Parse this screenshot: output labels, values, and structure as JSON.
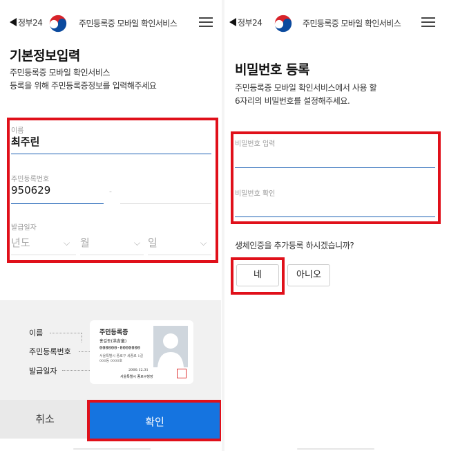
{
  "topbar": {
    "back_label": "정부24",
    "service_title": "주민등록증 모바일 확인서비스",
    "logo_icon": "gov-taegeuk-logo",
    "menu_icon": "hamburger-menu-icon"
  },
  "left": {
    "heading": "기본정보입력",
    "description_line1": "주민등록증 모바일 확인서비스",
    "description_line2": "등록을 위해 주민등록증정보를 입력해주세요",
    "name_label": "이름",
    "name_value": "최주린",
    "rrn_label": "주민등록번호",
    "rrn_front": "950629",
    "rrn_separator": "-",
    "issue_label": "발급일자",
    "year_placeholder": "년도",
    "month_placeholder": "월",
    "day_placeholder": "일",
    "example": {
      "label_name": "이름",
      "label_rrn": "주민등록번호",
      "label_issue": "발급일자",
      "card_title": "주민등록증",
      "card_name": "홍길동(洪吉童)",
      "card_number": "000000-0000000",
      "card_address1": "서울특별시 종로구 세종로 1길",
      "card_address2": "000동 0000호",
      "card_date": "2000.12.31",
      "card_issuer": "서울특별시 종로구청장"
    },
    "cancel_label": "취소",
    "confirm_label": "확인"
  },
  "right": {
    "heading": "비밀번호 등록",
    "description_line1": "주민등록증 모바일 확인서비스에서 사용 할",
    "description_line2": "6자리의 비밀번호를 설정해주세요.",
    "pw_label": "비밀번호 입력",
    "pw_confirm_label": "비밀번호 확인",
    "biometric_question": "생체인증을 추가등록 하시겠습니까?",
    "yes_label": "네",
    "no_label": "아니오"
  },
  "colors": {
    "accent": "#1574e0",
    "highlight": "#e0101a",
    "underline": "#1a5fb4"
  }
}
